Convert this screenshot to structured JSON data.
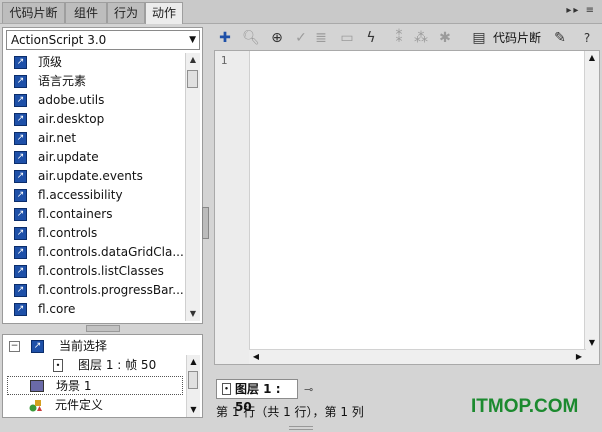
{
  "tabs": [
    {
      "label": "代码片断"
    },
    {
      "label": "组件"
    },
    {
      "label": "行为"
    },
    {
      "label": "动作"
    }
  ],
  "tabbar_menu": "▸▸ ≡",
  "language_select": {
    "value": "ActionScript 3.0"
  },
  "packages": [
    {
      "label": "顶级"
    },
    {
      "label": "语言元素"
    },
    {
      "label": "adobe.utils"
    },
    {
      "label": "air.desktop"
    },
    {
      "label": "air.net"
    },
    {
      "label": "air.update"
    },
    {
      "label": "air.update.events"
    },
    {
      "label": "fl.accessibility"
    },
    {
      "label": "fl.containers"
    },
    {
      "label": "fl.controls"
    },
    {
      "label": "fl.controls.dataGridCla..."
    },
    {
      "label": "fl.controls.listClasses"
    },
    {
      "label": "fl.controls.progressBar..."
    },
    {
      "label": "fl.core"
    }
  ],
  "tree": {
    "current_selection": "当前选择",
    "layer_frame": "图层 1 : 帧 50",
    "scene": "场景 1",
    "symbol_defs": "元件定义"
  },
  "toolbar": {
    "code_snippets_label": "代码片断"
  },
  "editor": {
    "line_numbers": [
      "1"
    ]
  },
  "layer_tab": {
    "label": "图层 1 : 50"
  },
  "status_text": "第 1 行（共 1 行），第 1 列",
  "watermark": "ITMOP.COM",
  "colors": {
    "watermark": "#1c8a2f",
    "icon_blue": "#1e50a8"
  }
}
